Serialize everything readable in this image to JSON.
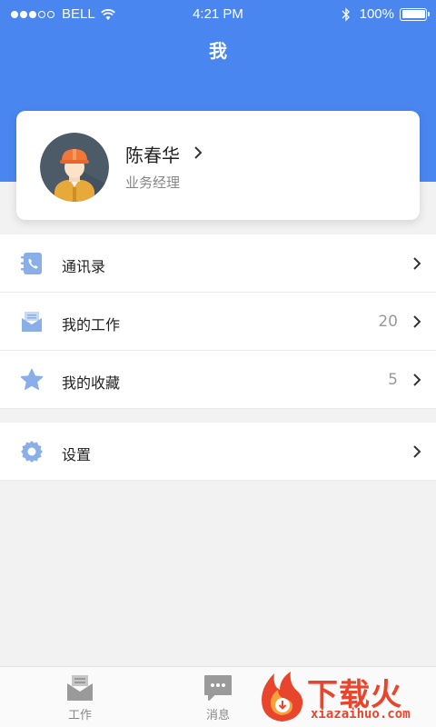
{
  "status_bar": {
    "carrier": "BELL",
    "time": "4:21 PM",
    "battery": "100%"
  },
  "header": {
    "title": "我"
  },
  "profile": {
    "name": "陈春华",
    "role": "业务经理"
  },
  "menu": [
    {
      "label": "通讯录",
      "count": "",
      "icon": "contacts-icon"
    },
    {
      "label": "我的工作",
      "count": "20",
      "icon": "work-mail-icon"
    },
    {
      "label": "我的收藏",
      "count": "5",
      "icon": "star-icon"
    }
  ],
  "settings": {
    "label": "设置",
    "icon": "gear-icon"
  },
  "tabs": [
    {
      "label": "工作",
      "icon": "work-tab-icon"
    },
    {
      "label": "消息",
      "icon": "message-tab-icon"
    }
  ],
  "watermark": {
    "brand": "下载火",
    "site": "xiazaihuo.com"
  },
  "colors": {
    "primary": "#4a86f0",
    "icon": "#8aaee8",
    "watermark": "#e8452c"
  }
}
